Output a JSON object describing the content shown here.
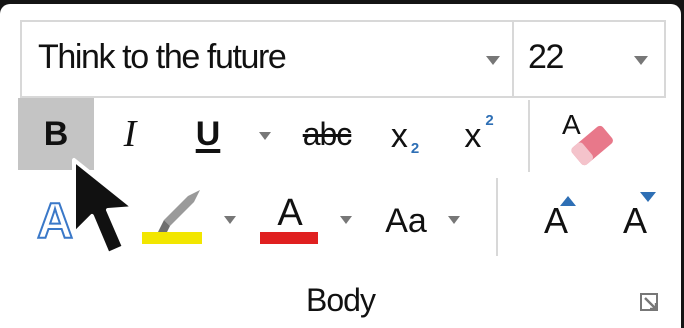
{
  "font_group": {
    "font_name": {
      "value": "Think to the future"
    },
    "font_size": {
      "value": "22"
    },
    "buttons": {
      "bold": "B",
      "italic": "I",
      "underline": "U",
      "strikethrough": "abc",
      "subscript_x": "x",
      "subscript_n": "2",
      "superscript_x": "x",
      "superscript_n": "2",
      "clear_formatting_letter": "A",
      "text_effects": "A",
      "font_color_letter": "A",
      "change_case": "Aa",
      "grow_font": "A",
      "shrink_font": "A"
    },
    "colors": {
      "highlight": "#f2e600",
      "font_color": "#e02020",
      "accent": "#2e6fb5",
      "eraser": "#e8788a",
      "bold_active_bg": "#c4c4c4"
    },
    "icons": [
      "chevron-down-icon",
      "paint-brush-icon",
      "eraser-icon",
      "grow-arrow-icon",
      "shrink-arrow-icon",
      "dialog-launcher-icon",
      "mouse-pointer-icon"
    ],
    "label": "Body"
  }
}
